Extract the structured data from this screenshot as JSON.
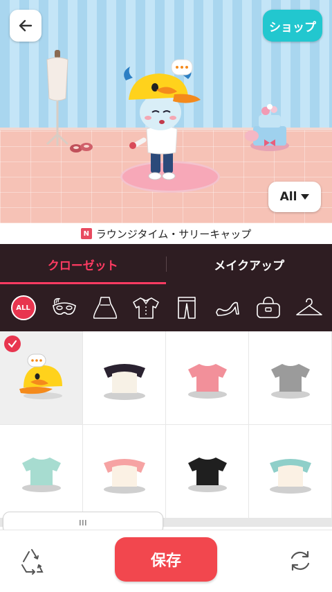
{
  "header": {
    "shop_label": "ショップ"
  },
  "scene": {
    "filter_label": "All",
    "item_name": "ラウンジタイム・サリーキャップ",
    "item_badge": "N"
  },
  "tabs": [
    {
      "label": "クローゼット",
      "active": true
    },
    {
      "label": "メイクアップ",
      "active": false
    }
  ],
  "categories": [
    {
      "icon": "all-icon",
      "label": "ALL",
      "selected": true
    },
    {
      "icon": "mask-icon"
    },
    {
      "icon": "dress-icon"
    },
    {
      "icon": "shirt-icon"
    },
    {
      "icon": "pants-icon"
    },
    {
      "icon": "heel-shoe-icon"
    },
    {
      "icon": "bag-icon"
    },
    {
      "icon": "hanger-icon"
    }
  ],
  "items": [
    {
      "name": "duck-cap",
      "selected": true
    },
    {
      "name": "black-cream-top",
      "colors": [
        "#2a2230",
        "#f7f1e6"
      ]
    },
    {
      "name": "pink-tshirt",
      "colors": [
        "#f2909a"
      ]
    },
    {
      "name": "gray-tshirt",
      "colors": [
        "#9b9b9b"
      ]
    },
    {
      "name": "mint-tshirt",
      "colors": [
        "#a7dcd0"
      ]
    },
    {
      "name": "pink-cream-top",
      "colors": [
        "#f6a3a3",
        "#fbf1e4"
      ]
    },
    {
      "name": "black-tshirt",
      "colors": [
        "#1f1f1f"
      ]
    },
    {
      "name": "teal-cream-top",
      "colors": [
        "#8fcfc9",
        "#fbf1e4"
      ]
    }
  ],
  "bottom": {
    "save_label": "保存"
  },
  "colors": {
    "accent": "#ff3b62",
    "save": "#f2474e",
    "shop": "#22c7cf",
    "panel": "#2e1d22"
  }
}
